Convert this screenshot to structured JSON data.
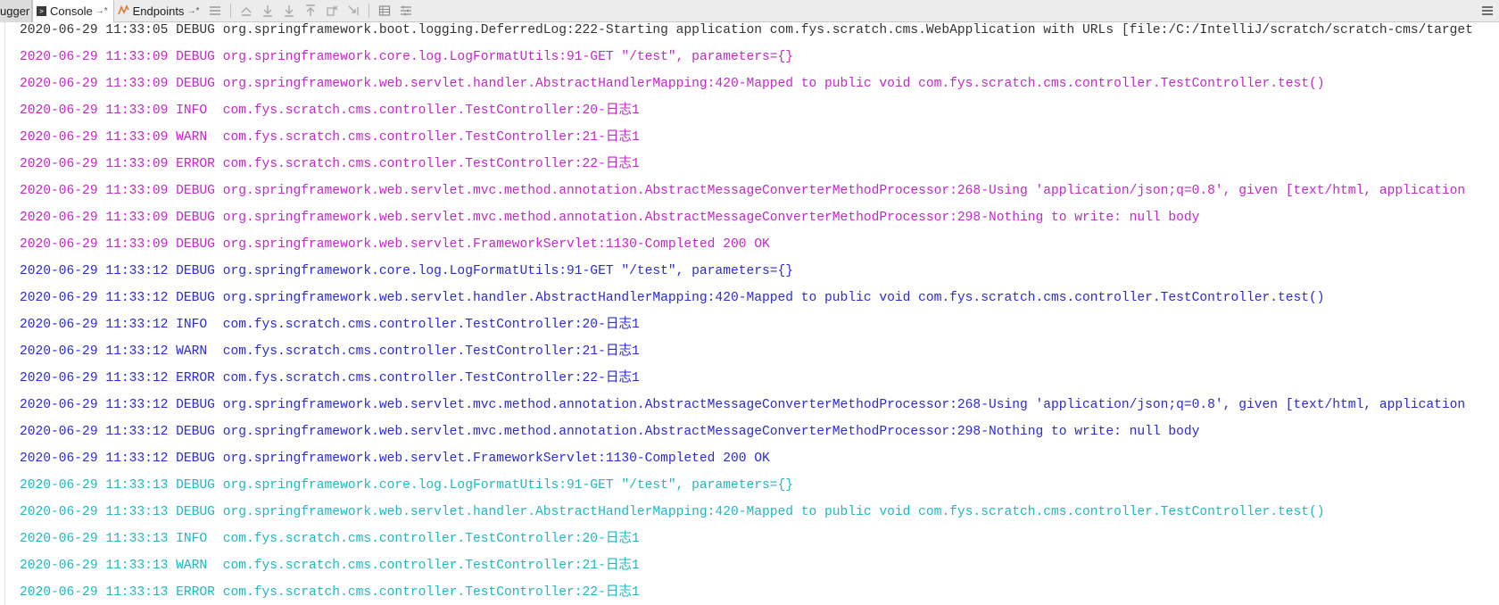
{
  "toolbar": {
    "tabs": [
      {
        "label": "ugger",
        "pin": ""
      },
      {
        "label": "Console",
        "pin": "→*"
      },
      {
        "label": "Endpoints",
        "pin": "→*"
      }
    ],
    "icons": [
      "menu-icon",
      "scroll-up-icon",
      "scroll-down-icon",
      "download-icon",
      "upload-icon",
      "clear-icon",
      "step-icon",
      "grid-icon",
      "settings-icon",
      "hamburger-icon"
    ]
  },
  "colors": {
    "gray": "#333333",
    "pink": "#c328c8",
    "blue": "#2a2ad6",
    "cyan": "#1fb8c0"
  },
  "log": {
    "lines": [
      {
        "color": "gray",
        "text": "2020-06-29 11:33:05 DEBUG org.springframework.boot.logging.DeferredLog:222-Starting application com.fys.scratch.cms.WebApplication with URLs [file:/C:/IntelliJ/scratch/scratch-cms/target"
      },
      {
        "color": "pink",
        "text": "2020-06-29 11:33:09 DEBUG org.springframework.core.log.LogFormatUtils:91-GET \"/test\", parameters={}"
      },
      {
        "color": "pink",
        "text": "2020-06-29 11:33:09 DEBUG org.springframework.web.servlet.handler.AbstractHandlerMapping:420-Mapped to public void com.fys.scratch.cms.controller.TestController.test()"
      },
      {
        "color": "pink",
        "text": "2020-06-29 11:33:09 INFO  com.fys.scratch.cms.controller.TestController:20-日志1"
      },
      {
        "color": "pink",
        "text": "2020-06-29 11:33:09 WARN  com.fys.scratch.cms.controller.TestController:21-日志1"
      },
      {
        "color": "pink",
        "text": "2020-06-29 11:33:09 ERROR com.fys.scratch.cms.controller.TestController:22-日志1"
      },
      {
        "color": "pink",
        "text": "2020-06-29 11:33:09 DEBUG org.springframework.web.servlet.mvc.method.annotation.AbstractMessageConverterMethodProcessor:268-Using 'application/json;q=0.8', given [text/html, application"
      },
      {
        "color": "pink",
        "text": "2020-06-29 11:33:09 DEBUG org.springframework.web.servlet.mvc.method.annotation.AbstractMessageConverterMethodProcessor:298-Nothing to write: null body"
      },
      {
        "color": "pink",
        "text": "2020-06-29 11:33:09 DEBUG org.springframework.web.servlet.FrameworkServlet:1130-Completed 200 OK"
      },
      {
        "color": "blue",
        "text": "2020-06-29 11:33:12 DEBUG org.springframework.core.log.LogFormatUtils:91-GET \"/test\", parameters={}"
      },
      {
        "color": "blue",
        "text": "2020-06-29 11:33:12 DEBUG org.springframework.web.servlet.handler.AbstractHandlerMapping:420-Mapped to public void com.fys.scratch.cms.controller.TestController.test()"
      },
      {
        "color": "blue",
        "text": "2020-06-29 11:33:12 INFO  com.fys.scratch.cms.controller.TestController:20-日志1"
      },
      {
        "color": "blue",
        "text": "2020-06-29 11:33:12 WARN  com.fys.scratch.cms.controller.TestController:21-日志1"
      },
      {
        "color": "blue",
        "text": "2020-06-29 11:33:12 ERROR com.fys.scratch.cms.controller.TestController:22-日志1"
      },
      {
        "color": "blue",
        "text": "2020-06-29 11:33:12 DEBUG org.springframework.web.servlet.mvc.method.annotation.AbstractMessageConverterMethodProcessor:268-Using 'application/json;q=0.8', given [text/html, application"
      },
      {
        "color": "blue",
        "text": "2020-06-29 11:33:12 DEBUG org.springframework.web.servlet.mvc.method.annotation.AbstractMessageConverterMethodProcessor:298-Nothing to write: null body"
      },
      {
        "color": "blue",
        "text": "2020-06-29 11:33:12 DEBUG org.springframework.web.servlet.FrameworkServlet:1130-Completed 200 OK"
      },
      {
        "color": "cyan",
        "text": "2020-06-29 11:33:13 DEBUG org.springframework.core.log.LogFormatUtils:91-GET \"/test\", parameters={}"
      },
      {
        "color": "cyan",
        "text": "2020-06-29 11:33:13 DEBUG org.springframework.web.servlet.handler.AbstractHandlerMapping:420-Mapped to public void com.fys.scratch.cms.controller.TestController.test()"
      },
      {
        "color": "cyan",
        "text": "2020-06-29 11:33:13 INFO  com.fys.scratch.cms.controller.TestController:20-日志1"
      },
      {
        "color": "cyan",
        "text": "2020-06-29 11:33:13 WARN  com.fys.scratch.cms.controller.TestController:21-日志1"
      },
      {
        "color": "cyan",
        "text": "2020-06-29 11:33:13 ERROR com.fys.scratch.cms.controller.TestController:22-日志1"
      }
    ]
  }
}
